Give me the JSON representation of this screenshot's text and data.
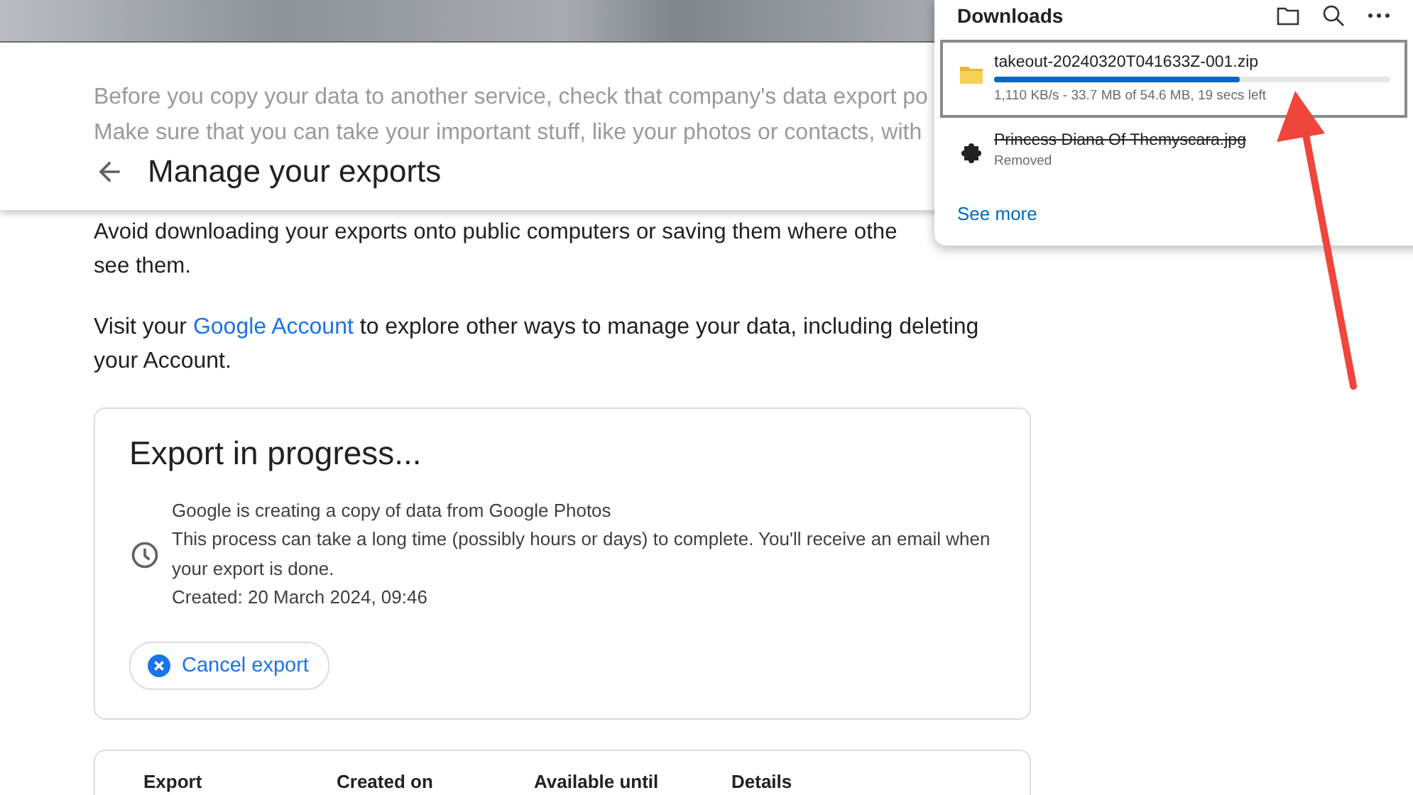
{
  "faded_intro": [
    "Before you copy your data to another service, check that company's data export po",
    "Make sure that you can take your important stuff, like your photos or contacts, with"
  ],
  "header": {
    "title": "Manage your exports"
  },
  "warning": {
    "lines": [
      "Avoid downloading your exports onto public computers or saving them where othe",
      "see them."
    ]
  },
  "account_note": {
    "before": "Visit your ",
    "link": "Google Account",
    "after": " to explore other ways to manage your data, including deleting your Account."
  },
  "progress_card": {
    "title": "Export in progress...",
    "lines": [
      "Google is creating a copy of data from Google Photos",
      "This process can take a long time (possibly hours or days) to complete. You'll receive an email when your export is done.",
      "Created: 20 March 2024, 09:46"
    ],
    "button": "Cancel export"
  },
  "exports_table": {
    "columns": [
      "Export",
      "Created on",
      "Available until",
      "Details"
    ]
  },
  "downloads": {
    "title": "Downloads",
    "items": [
      {
        "kind": "active",
        "file": "takeout-20240320T041633Z-001.zip",
        "level": 0.62,
        "status": "1,110 KB/s - 33.7 MB of 54.6 MB, 19 secs left",
        "selected": true
      },
      {
        "kind": "removed",
        "file": "Princess Diana Of Themyscara.jpg",
        "status": "Removed",
        "selected": false
      }
    ],
    "see_more": "See more"
  }
}
